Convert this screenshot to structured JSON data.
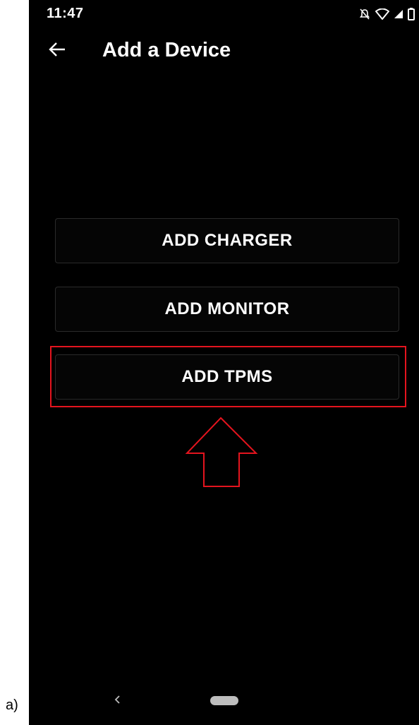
{
  "panel_label": "a)",
  "status_bar": {
    "time": "11:47",
    "icons": [
      "notifications-off-icon",
      "wifi-icon",
      "signal-icon",
      "battery-icon"
    ]
  },
  "app_bar": {
    "back_icon": "arrow-left-icon",
    "title": "Add a Device"
  },
  "buttons": {
    "add_charger": "ADD CHARGER",
    "add_monitor": "ADD MONITOR",
    "add_tpms": "ADD TPMS"
  },
  "annotation": {
    "highlight_color": "#e4141e",
    "arrow_icon": "up-arrow-icon"
  },
  "nav_bar": {
    "back_icon": "chevron-left-icon",
    "home_icon": "home-pill-icon"
  },
  "colors": {
    "screen_background": "#000000",
    "text": "#ffffff",
    "button_border": "#2a2a2a"
  }
}
